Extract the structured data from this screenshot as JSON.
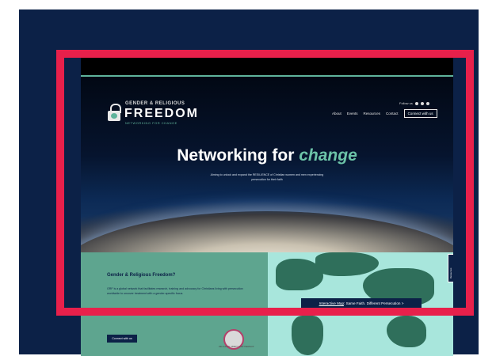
{
  "site": {
    "logo": {
      "line1": "GENDER & RELIGIOUS",
      "line2": "FREEDOM",
      "line3": "NETWORKING FOR CHANGE"
    },
    "follow_label": "Follow us",
    "nav": [
      "About",
      "Events",
      "Resources",
      "Contact"
    ],
    "connect_label": "Connect with us",
    "hero": {
      "title_prefix": "Networking for",
      "title_highlight": "change",
      "tagline": "Aiming to unlock and expand the RESILIENCE of Christian women and men experiencing persecution for their faith"
    },
    "intro": {
      "title": "Gender & Religious Freedom?",
      "body": "GRF is a global network that facilitates research, training and advocacy for Christians living with persecution worldwide to uncover treatment with a gender-specific focus.",
      "note": "WE ARE A THEMATIC ARM OF THE RELIGIOUS LIBERTY PARTNERSHIP (RLP)",
      "button_label": "Connect with us",
      "badge_label": "RELIGIOUS LIBERTY PARTNERSHIP"
    },
    "map": {
      "link_label": "Interactive Map",
      "link_rest": ": Same Faith. Different Persecution >",
      "side_tab_label": "Resources"
    }
  },
  "colors": {
    "navy": "#0c2147",
    "teal": "#5ea58f",
    "mint": "#a8e6dc",
    "accent_green": "#6cc3a8",
    "frame_red": "#e8204b"
  }
}
